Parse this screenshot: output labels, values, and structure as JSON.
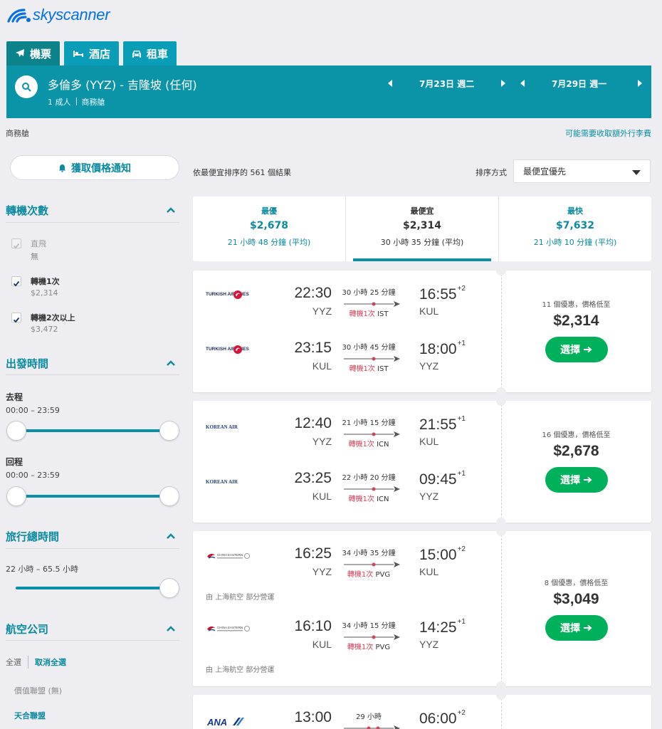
{
  "brand": {
    "name": "skyscanner",
    "color": "#0770e3"
  },
  "tabs": [
    {
      "label": "機票",
      "icon": "plane-icon",
      "active": true
    },
    {
      "label": "酒店",
      "icon": "bed-icon",
      "active": false
    },
    {
      "label": "租車",
      "icon": "car-icon",
      "active": false
    }
  ],
  "search": {
    "route": "多倫多 (YYZ) - 吉隆坡 (任何)",
    "passengers": "1 成人",
    "cabin": "商務艙",
    "depart_date": "7月23日 週二",
    "return_date": "7月29日 週一"
  },
  "cabin_label": "商務艙",
  "baggage_link": "可能需要收取額外行李費",
  "sidebar": {
    "alert_button": "獲取價格通知",
    "stops": {
      "title": "轉機次數",
      "options": [
        {
          "label": "直飛",
          "price": "無",
          "checked": true,
          "disabled": true
        },
        {
          "label": "轉機1次",
          "price": "$2,314",
          "checked": true,
          "disabled": false
        },
        {
          "label": "轉機2次以上",
          "price": "$3,472",
          "checked": true,
          "disabled": false
        }
      ]
    },
    "times": {
      "title": "出發時間",
      "outbound_label": "去程",
      "outbound_range": "00:00 – 23:59",
      "return_label": "回程",
      "return_range": "00:00 – 23:59"
    },
    "duration": {
      "title": "旅行總時間",
      "range": "22 小時 – 65.5 小時"
    },
    "airlines": {
      "title": "航空公司",
      "select_all": "全選",
      "deselect_all": "取消全選",
      "alliance_none": "價值聯盟 (無)",
      "alliance_skyteam": "天合聯盟"
    }
  },
  "results": {
    "count_text": "依最便宜排序的 561 個結果",
    "sort_label": "排序方式",
    "sort_value": "最便宜優先"
  },
  "summary": [
    {
      "name": "最優",
      "price": "$2,678",
      "duration": "21 小時 48 分鐘 (平均)",
      "active": false
    },
    {
      "name": "最便宜",
      "price": "$2,314",
      "duration": "30 小時 35 分鐘 (平均)",
      "active": true
    },
    {
      "name": "最快",
      "price": "$7,632",
      "duration": "21 小時 10 分鐘 (平均)",
      "active": false
    }
  ],
  "cards": [
    {
      "airline": "TURKISH AIRLINES",
      "legs": [
        {
          "dep_time": "22:30",
          "dep_code": "YYZ",
          "duration": "30 小時 25 分鐘",
          "stops": "轉機1次",
          "via": "IST",
          "arr_time": "16:55",
          "day_offset": "+2",
          "arr_code": "KUL"
        },
        {
          "dep_time": "23:15",
          "dep_code": "KUL",
          "duration": "30 小時 45 分鐘",
          "stops": "轉機1次",
          "via": "IST",
          "arr_time": "18:00",
          "day_offset": "+1",
          "arr_code": "YYZ"
        }
      ],
      "deals": "11 個優惠，價格低至",
      "price": "$2,314",
      "select_label": "選擇"
    },
    {
      "airline": "KOREAN AIR",
      "legs": [
        {
          "dep_time": "12:40",
          "dep_code": "YYZ",
          "duration": "21 小時 15 分鐘",
          "stops": "轉機1次",
          "via": "ICN",
          "arr_time": "21:55",
          "day_offset": "+1",
          "arr_code": "KUL"
        },
        {
          "dep_time": "23:25",
          "dep_code": "KUL",
          "duration": "22 小時 20 分鐘",
          "stops": "轉機1次",
          "via": "ICN",
          "arr_time": "09:45",
          "day_offset": "+1",
          "arr_code": "YYZ"
        }
      ],
      "deals": "16 個優惠，價格低至",
      "price": "$2,678",
      "select_label": "選擇"
    },
    {
      "airline": "CHINA EASTERN",
      "legs": [
        {
          "dep_time": "16:25",
          "dep_code": "YYZ",
          "duration": "34 小時 35 分鐘",
          "stops": "轉機1次",
          "via": "PVG",
          "arr_time": "15:00",
          "day_offset": "+2",
          "arr_code": "KUL",
          "operated": "由 上海航空 部分營運"
        },
        {
          "dep_time": "16:10",
          "dep_code": "KUL",
          "duration": "34 小時 15 分鐘",
          "stops": "轉機1次",
          "via": "PVG",
          "arr_time": "14:25",
          "day_offset": "+1",
          "arr_code": "YYZ",
          "operated": "由 上海航空 部分營運"
        }
      ],
      "deals": "8 個優惠，價格低至",
      "price": "$3,049",
      "select_label": "選擇"
    },
    {
      "airline": "ANA",
      "legs": [
        {
          "dep_time": "13:00",
          "duration": "29 小時",
          "arr_time": "06:00",
          "day_offset": "+2"
        }
      ]
    }
  ]
}
